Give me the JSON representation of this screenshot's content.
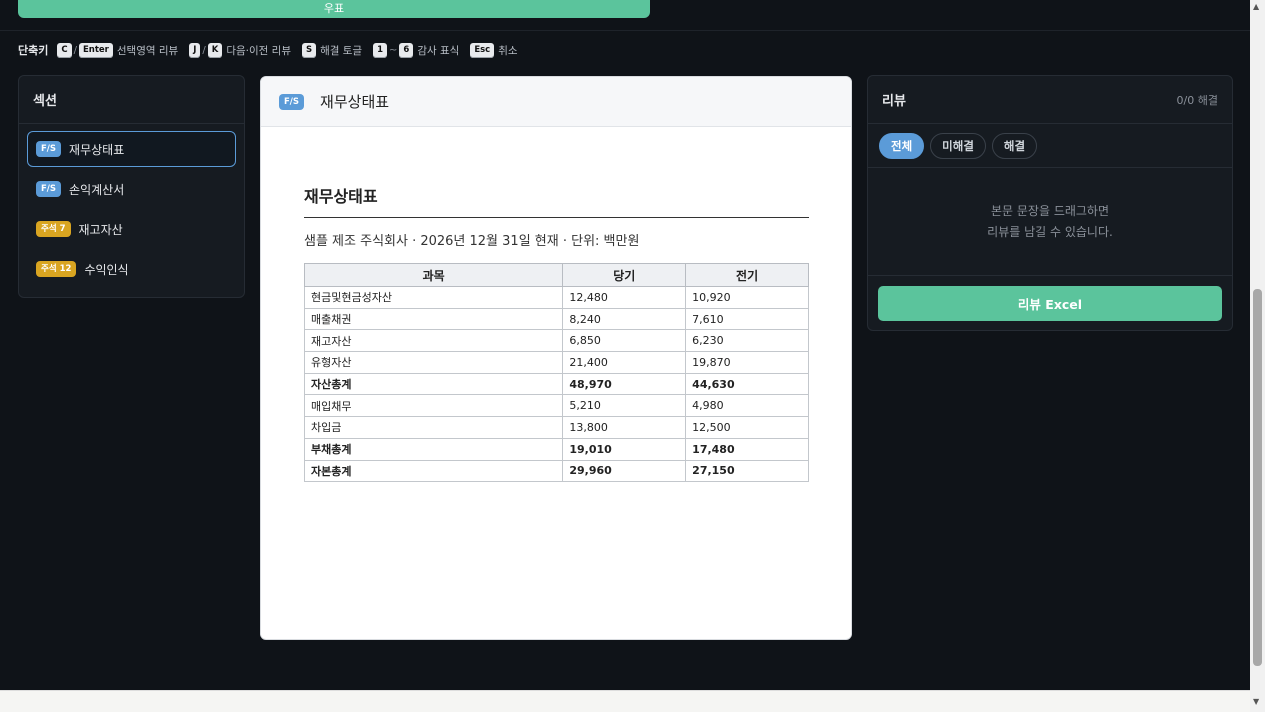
{
  "top_button": {
    "label": "우표"
  },
  "shortcuts": {
    "title": "단축키",
    "items": [
      {
        "keys": [
          "C",
          "Enter"
        ],
        "desc": "선택영역 리뷰"
      },
      {
        "keys": [
          "J",
          "K"
        ],
        "desc": "다음·이전 리뷰"
      },
      {
        "keys": [
          "S"
        ],
        "desc": "해결 토글"
      },
      {
        "keys": [
          "1",
          "6"
        ],
        "desc": "감사 표식"
      },
      {
        "keys": [
          "Esc"
        ],
        "desc": "취소"
      }
    ]
  },
  "sections": {
    "title": "섹션",
    "items": [
      {
        "badge": "F/S",
        "label": "재무상태표",
        "active": true
      },
      {
        "badge": "F/S",
        "label": "손익계산서"
      },
      {
        "badge": "주석 7",
        "label": "재고자산"
      },
      {
        "badge": "주석 12",
        "label": "수익인식"
      }
    ]
  },
  "document": {
    "header_badge": "F/S",
    "header_title": "재무상태표",
    "heading": "재무상태표",
    "subtitle": "샘플 제조 주식회사 · 2026년 12월 31일 현재 · 단위: 백만원",
    "table": {
      "headers": [
        "과목",
        "당기",
        "전기"
      ],
      "rows": [
        [
          "현금및현금성자산",
          "12,480",
          "10,920"
        ],
        [
          "매출채권",
          "8,240",
          "7,610"
        ],
        [
          "재고자산",
          "6,850",
          "6,230"
        ],
        [
          "유형자산",
          "21,400",
          "19,870"
        ],
        [
          "자산총계",
          "48,970",
          "44,630"
        ],
        [
          "매입채무",
          "5,210",
          "4,980"
        ],
        [
          "차입금",
          "13,800",
          "12,500"
        ],
        [
          "부채총계",
          "19,010",
          "17,480"
        ],
        [
          "자본총계",
          "29,960",
          "27,150"
        ]
      ]
    }
  },
  "review": {
    "title": "리뷰",
    "count": "0/0 해결",
    "filters": [
      "전체",
      "미해결",
      "해결"
    ],
    "empty_line1": "본문 문장을 드래그하면",
    "empty_line2": "리뷰를 남길 수 있습니다.",
    "excel_button": "리뷰 Excel"
  }
}
